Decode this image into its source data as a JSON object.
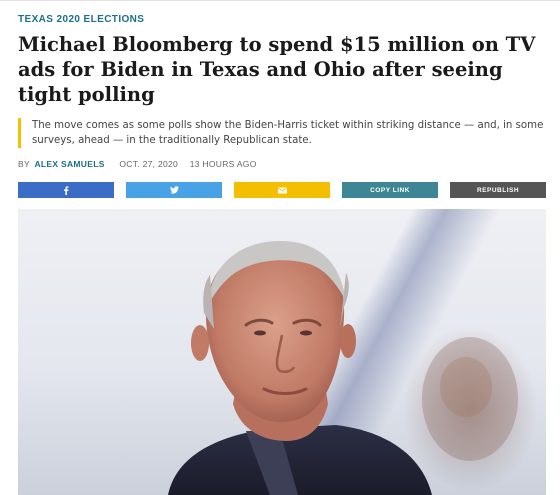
{
  "section": "Texas 2020 Elections",
  "headline": "Michael Bloomberg to spend $15 million on TV ads for Biden in Texas and Ohio after seeing tight polling",
  "summary": "The move comes as some polls show the Biden-Harris ticket within striking distance — and, in some surveys, ahead — in the traditionally Republican state.",
  "byline": {
    "prefix": "BY",
    "author": "ALEX SAMUELS",
    "date": "OCT. 27, 2020",
    "relative_time": "13 HOURS AGO"
  },
  "share_buttons": [
    {
      "name": "facebook",
      "icon": "facebook-icon",
      "color": "#3b6cc6"
    },
    {
      "name": "twitter",
      "icon": "twitter-icon",
      "color": "#4aa2e6"
    },
    {
      "name": "email",
      "icon": "envelope-icon",
      "color": "#f3bf00"
    },
    {
      "name": "copy-link",
      "label": "COPY LINK",
      "color": "#3f8694"
    },
    {
      "name": "republish",
      "label": "REPUBLISH",
      "color": "#555555"
    }
  ],
  "accent_color": "#f5c100",
  "link_color": "#1c6f8a"
}
